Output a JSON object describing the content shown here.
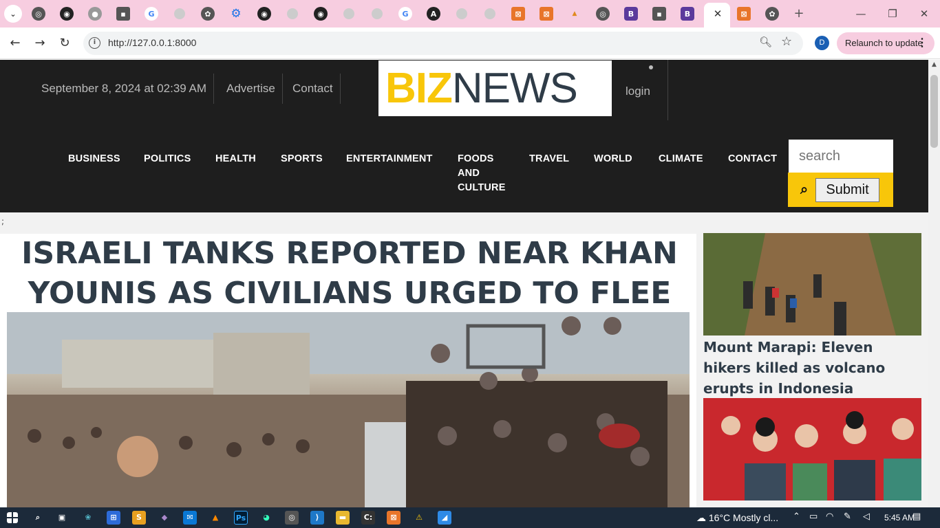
{
  "browser": {
    "url": "http://127.0.0.1:8000",
    "profile_initial": "D",
    "relaunch_label": "Relaunch to update",
    "menu_glyph": "⋮",
    "active_tab_close": "✕",
    "new_tab": "+"
  },
  "site": {
    "date": "September 8, 2024 at 02:39 AM",
    "top_links": [
      "Advertise",
      "Contact"
    ],
    "logo": {
      "biz": "BIZ",
      "news": "NEWS"
    },
    "login": "login",
    "nav": [
      "BUSINESS",
      "POLITICS",
      "HEALTH",
      "SPORTS",
      "ENTERTAINMENT",
      "FOODS AND CULTURE",
      "TRAVEL",
      "WORLD",
      "CLIMATE",
      "CONTACT"
    ],
    "search_placeholder": "search",
    "submit_label": "Submit",
    "stray_text": ";"
  },
  "main": {
    "headline": "ISRAELI TANKS REPORTED NEAR KHAN YOUNIS AS CIVILIANS URGED TO FLEE"
  },
  "sidebar": {
    "story1_title": "Mount Marapi: Eleven hikers killed as volcano erupts in Indonesia"
  },
  "taskbar": {
    "weather": "16°C  Mostly cl...",
    "time": "5:45 AM"
  },
  "colors": {
    "tab_strip": "#f7cde0",
    "header_bg": "#1e1e1e",
    "accent_yellow": "#f8c60a",
    "headline_text": "#2f3c48"
  }
}
